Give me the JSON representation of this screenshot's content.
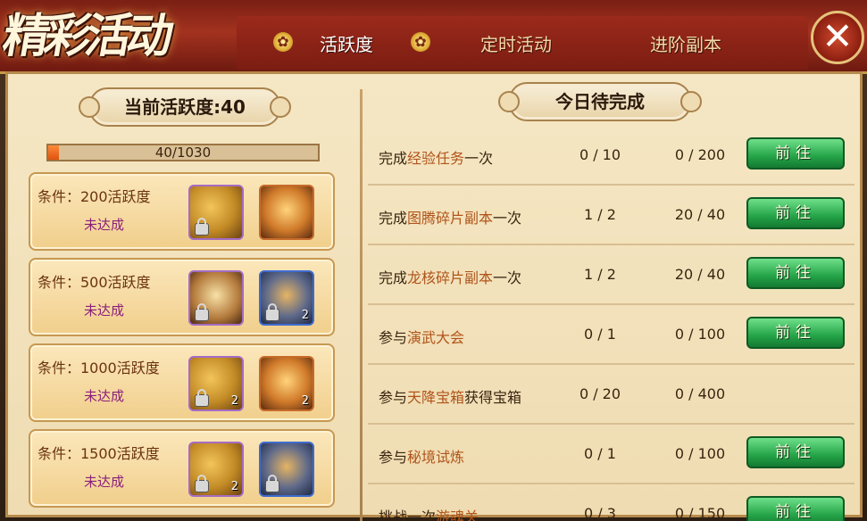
{
  "header": {
    "logo_text": "精彩活动",
    "tabs": [
      {
        "label": "活跃度",
        "active": true
      },
      {
        "label": "定时活动",
        "active": false
      },
      {
        "label": "进阶副本",
        "active": false
      }
    ],
    "close_icon": "close-icon",
    "close_glyph": "✕"
  },
  "left": {
    "current_label": "当前活跃度:40",
    "progress": {
      "text": "40/1030",
      "value": 40,
      "max": 1030
    },
    "rewards": [
      {
        "condition": "条件：200活跃度",
        "status": "未达成",
        "items": [
          {
            "type": "gold",
            "locked": true,
            "qty": ""
          },
          {
            "type": "roll",
            "locked": false,
            "qty": ""
          }
        ]
      },
      {
        "condition": "条件：500活跃度",
        "status": "未达成",
        "items": [
          {
            "type": "scroll",
            "locked": true,
            "qty": ""
          },
          {
            "type": "blue",
            "locked": true,
            "qty": "2"
          }
        ]
      },
      {
        "condition": "条件：1000活跃度",
        "status": "未达成",
        "items": [
          {
            "type": "gold",
            "locked": true,
            "qty": "2"
          },
          {
            "type": "roll",
            "locked": false,
            "qty": "2"
          }
        ]
      },
      {
        "condition": "条件：1500活跃度",
        "status": "未达成",
        "items": [
          {
            "type": "gold",
            "locked": true,
            "qty": "2"
          },
          {
            "type": "blue",
            "locked": true,
            "qty": ""
          }
        ]
      }
    ]
  },
  "right": {
    "title": "今日待完成",
    "tasks": [
      {
        "prefix": "完成",
        "highlight": "经验任务",
        "suffix": "一次",
        "count": "0 / 10",
        "points": "0 / 200",
        "button": "前往"
      },
      {
        "prefix": "完成",
        "highlight": "图腾碎片副本",
        "suffix": "一次",
        "count": "1 / 2",
        "points": "20 / 40",
        "button": "前往"
      },
      {
        "prefix": "完成",
        "highlight": "龙核碎片副本",
        "suffix": "一次",
        "count": "1 / 2",
        "points": "20 / 40",
        "button": "前往"
      },
      {
        "prefix": "参与",
        "highlight": "演武大会",
        "suffix": "",
        "count": "0 / 1",
        "points": "0 / 100",
        "button": "前往"
      },
      {
        "prefix": "参与",
        "highlight": "天降宝箱",
        "suffix": "获得宝箱",
        "count": "0 / 20",
        "points": "0 / 400",
        "button": ""
      },
      {
        "prefix": "参与",
        "highlight": "秘境试炼",
        "suffix": "",
        "count": "0 / 1",
        "points": "0 / 100",
        "button": "前往"
      },
      {
        "prefix": "挑战一次",
        "highlight": "游魂关",
        "suffix": "",
        "count": "0 / 3",
        "points": "0 / 150",
        "button": "前往"
      }
    ]
  }
}
